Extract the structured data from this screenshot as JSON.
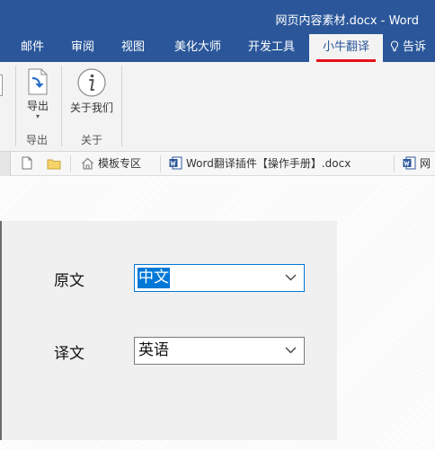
{
  "window": {
    "title": "网页内容素材.docx - Word"
  },
  "ribbon_tabs": [
    {
      "label": "邮件"
    },
    {
      "label": "审阅"
    },
    {
      "label": "视图"
    },
    {
      "label": "美化大师"
    },
    {
      "label": "开发工具"
    },
    {
      "label": "小牛翻译",
      "active": true
    },
    {
      "label": "告诉"
    }
  ],
  "ribbon": {
    "export_button": "导出",
    "export_group": "导出",
    "about_button": "关于我们",
    "about_group": "关于"
  },
  "doc_tabs": [
    {
      "label": "模板专区"
    },
    {
      "label": "Word翻译插件【操作手册】.docx"
    },
    {
      "label": "网"
    }
  ],
  "dialog": {
    "source_label": "原文",
    "source_value": "中文",
    "target_label": "译文",
    "target_value": "英语"
  },
  "colors": {
    "accent": "#2b579a",
    "active_underline": "#e8101b",
    "selection": "#0078d7"
  }
}
